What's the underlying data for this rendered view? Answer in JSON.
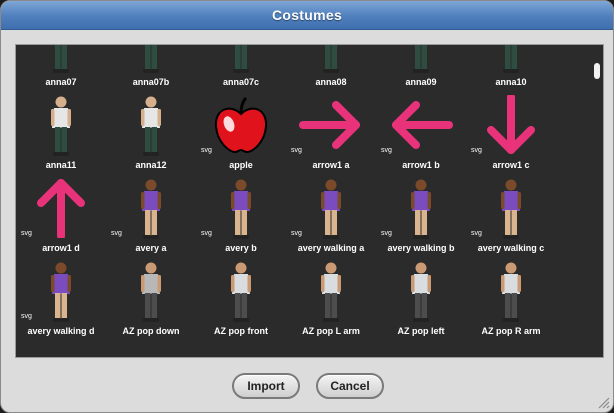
{
  "dialog": {
    "title": "Costumes",
    "import_label": "Import",
    "cancel_label": "Cancel"
  },
  "costumes": [
    {
      "name": "anna07",
      "svg": false,
      "kind": "person",
      "shirt": "#e6e6e6",
      "legs": "#2e4d40",
      "skin": "#d6b08c"
    },
    {
      "name": "anna07b",
      "svg": false,
      "kind": "person",
      "shirt": "#e6e6e6",
      "legs": "#2e4d40",
      "skin": "#d6b08c"
    },
    {
      "name": "anna07c",
      "svg": false,
      "kind": "person",
      "shirt": "#e6e6e6",
      "legs": "#2e4d40",
      "skin": "#d6b08c"
    },
    {
      "name": "anna08",
      "svg": false,
      "kind": "person",
      "shirt": "#e6e6e6",
      "legs": "#2e4d40",
      "skin": "#d6b08c"
    },
    {
      "name": "anna09",
      "svg": false,
      "kind": "person",
      "shirt": "#e6e6e6",
      "legs": "#2e4d40",
      "skin": "#d6b08c"
    },
    {
      "name": "anna10",
      "svg": false,
      "kind": "person",
      "shirt": "#e6e6e6",
      "legs": "#2e4d40",
      "skin": "#d6b08c"
    },
    {
      "name": "anna11",
      "svg": false,
      "kind": "person",
      "shirt": "#e6e6e6",
      "legs": "#2e4d40",
      "skin": "#d6b08c"
    },
    {
      "name": "anna12",
      "svg": false,
      "kind": "person",
      "shirt": "#e6e6e6",
      "legs": "#2e4d40",
      "skin": "#d6b08c"
    },
    {
      "name": "apple",
      "svg": true,
      "kind": "apple"
    },
    {
      "name": "arrow1 a",
      "svg": true,
      "kind": "arrow-right"
    },
    {
      "name": "arrow1 b",
      "svg": true,
      "kind": "arrow-left"
    },
    {
      "name": "arrow1 c",
      "svg": true,
      "kind": "arrow-down"
    },
    {
      "name": "arrow1 d",
      "svg": true,
      "kind": "arrow-up"
    },
    {
      "name": "avery a",
      "svg": true,
      "kind": "person",
      "shirt": "#7b4cc0",
      "legs": "#d9b48f",
      "skin": "#7a4a2a"
    },
    {
      "name": "avery b",
      "svg": true,
      "kind": "person",
      "shirt": "#7b4cc0",
      "legs": "#d9b48f",
      "skin": "#7a4a2a"
    },
    {
      "name": "avery walking a",
      "svg": true,
      "kind": "person",
      "shirt": "#7b4cc0",
      "legs": "#d9b48f",
      "skin": "#7a4a2a"
    },
    {
      "name": "avery walking b",
      "svg": true,
      "kind": "person",
      "shirt": "#7b4cc0",
      "legs": "#d9b48f",
      "skin": "#7a4a2a"
    },
    {
      "name": "avery walking c",
      "svg": true,
      "kind": "person",
      "shirt": "#7b4cc0",
      "legs": "#d9b48f",
      "skin": "#7a4a2a"
    },
    {
      "name": "avery walking d",
      "svg": true,
      "kind": "person",
      "shirt": "#7b4cc0",
      "legs": "#d9b48f",
      "skin": "#7a4a2a"
    },
    {
      "name": "AZ pop down",
      "svg": false,
      "kind": "person",
      "shirt": "#b8b8b8",
      "legs": "#4d4d4d",
      "skin": "#c99a74"
    },
    {
      "name": "AZ pop front",
      "svg": false,
      "kind": "person",
      "shirt": "#d9dde0",
      "legs": "#4d4d4d",
      "skin": "#c99a74"
    },
    {
      "name": "AZ pop L arm",
      "svg": false,
      "kind": "person",
      "shirt": "#d9dde0",
      "legs": "#4d4d4d",
      "skin": "#c99a74"
    },
    {
      "name": "AZ pop left",
      "svg": false,
      "kind": "person",
      "shirt": "#d9dde0",
      "legs": "#4d4d4d",
      "skin": "#c99a74"
    },
    {
      "name": "AZ pop R arm",
      "svg": false,
      "kind": "person",
      "shirt": "#d9dde0",
      "legs": "#4d4d4d",
      "skin": "#c99a74"
    }
  ],
  "svg_tag": "svg",
  "colors": {
    "title_bar": "#4f7fbd",
    "panel": "#2b2b2b",
    "arrow": "#e8337a",
    "apple": "#e0121b"
  }
}
